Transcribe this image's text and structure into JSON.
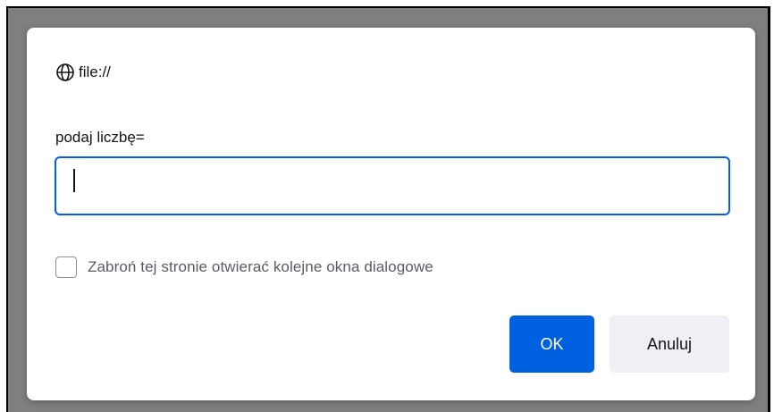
{
  "dialog": {
    "origin_text": "file://",
    "origin_icon": "globe-icon",
    "prompt_label": "podaj liczbę=",
    "input_value": "",
    "checkbox_label": "Zabroń tej stronie otwierać kolejne okna dialogowe",
    "checkbox_checked": false,
    "ok_label": "OK",
    "cancel_label": "Anuluj"
  },
  "colors": {
    "accent": "#0061e0",
    "backdrop": "#7f7f7f",
    "cancel_bg": "#f0f0f4"
  }
}
